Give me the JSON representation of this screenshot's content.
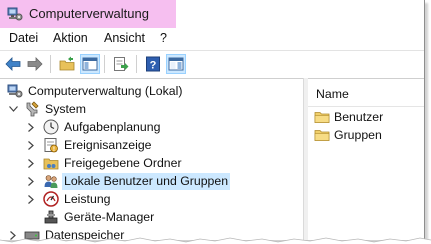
{
  "window": {
    "title": "Computerverwaltung"
  },
  "menu": {
    "items": [
      "Datei",
      "Aktion",
      "Ansicht",
      "?"
    ]
  },
  "toolbar": {
    "buttons": [
      "back-arrow-icon",
      "forward-arrow-icon",
      "folder-up-icon",
      "show-hide-console-tree-icon",
      "export-list-icon",
      "help-icon",
      "show-hide-action-pane-icon"
    ]
  },
  "tree": {
    "root": "Computerverwaltung (Lokal)",
    "system": "System",
    "children": [
      "Aufgabenplanung",
      "Ereignisanzeige",
      "Freigegebene Ordner",
      "Lokale Benutzer und Gruppen",
      "Leistung",
      "Geräte-Manager"
    ],
    "storage": "Datenspeicher"
  },
  "list": {
    "header": "Name",
    "items": [
      "Benutzer",
      "Gruppen"
    ]
  },
  "colors": {
    "title_highlight": "#f6bff0",
    "selection": "#cce8ff"
  }
}
